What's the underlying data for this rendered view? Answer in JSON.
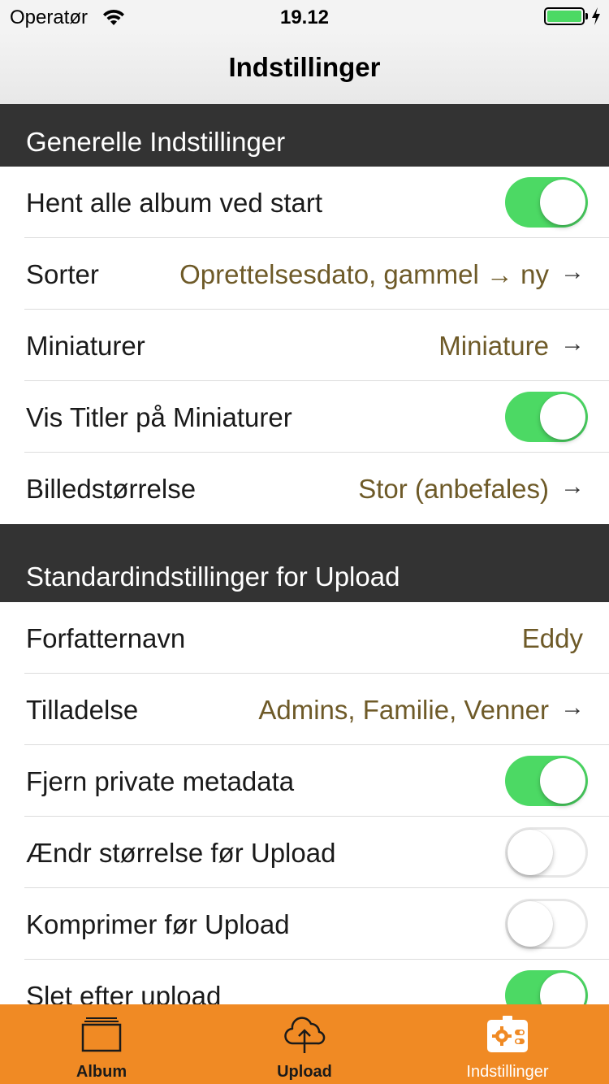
{
  "status_bar": {
    "carrier": "Operatør",
    "time": "19.12",
    "battery_color": "#4cd964"
  },
  "nav": {
    "title": "Indstillinger"
  },
  "sections": {
    "general": {
      "header": "Generelle Indstillinger",
      "rows": {
        "fetch_albums": {
          "label": "Hent alle album ved start",
          "on": true
        },
        "sort": {
          "label": "Sorter",
          "value": "Oprettelsesdato, gammel → ny",
          "arrow": "→"
        },
        "thumbnails": {
          "label": "Miniaturer",
          "value": "Miniature",
          "arrow": "→"
        },
        "show_titles": {
          "label": "Vis Titler på Miniaturer",
          "on": true
        },
        "image_size": {
          "label": "Billedstørrelse",
          "value": "Stor (anbefales)",
          "arrow": "→"
        }
      }
    },
    "upload": {
      "header": "Standardindstillinger for Upload",
      "rows": {
        "author": {
          "label": "Forfatternavn",
          "value": "Eddy"
        },
        "permission": {
          "label": "Tilladelse",
          "value": "Admins, Familie, Venner",
          "arrow": "→"
        },
        "strip_metadata": {
          "label": "Fjern private metadata",
          "on": true
        },
        "resize": {
          "label": "Ændr størrelse før Upload",
          "on": false
        },
        "compress": {
          "label": "Komprimer før Upload",
          "on": false
        },
        "delete_after": {
          "label": "Slet efter upload",
          "on": true
        }
      }
    }
  },
  "tab_bar": {
    "background": "#f08a24",
    "tabs": [
      {
        "label": "Album",
        "icon": "album-icon",
        "active": false
      },
      {
        "label": "Upload",
        "icon": "cloud-upload-icon",
        "active": false
      },
      {
        "label": "Indstillinger",
        "icon": "settings-icon",
        "active": true
      }
    ]
  },
  "colors": {
    "section_header_bg": "#333333",
    "value_text": "#6e5a28",
    "toggle_on": "#4cd964"
  }
}
